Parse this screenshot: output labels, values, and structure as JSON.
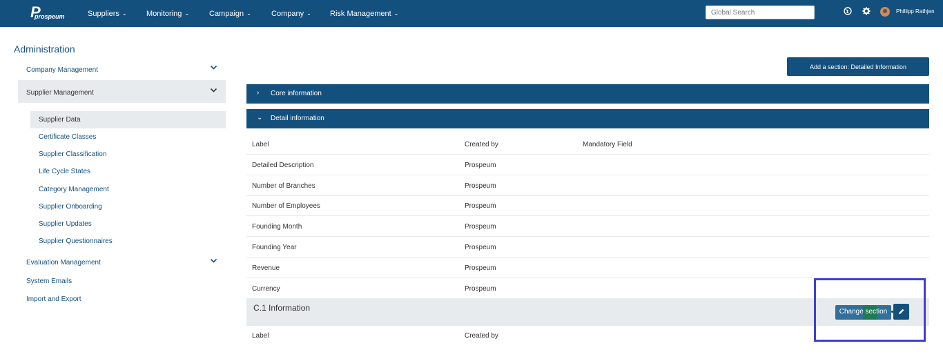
{
  "brand": {
    "logo_letter": "P",
    "logo_text": "prospeum"
  },
  "nav": {
    "items": [
      "Suppliers",
      "Monitoring",
      "Campaign",
      "Company",
      "Risk Management"
    ],
    "search_placeholder": "Global Search",
    "user_name": "Phillipp Rathjen",
    "icons": [
      "globe-icon",
      "gear-icon"
    ]
  },
  "sidebar": {
    "title": "Administration",
    "groups": [
      {
        "label": "Company Management"
      },
      {
        "label": "Supplier Management"
      },
      {
        "label": "Evaluation Management"
      },
      {
        "label": "System Emails"
      },
      {
        "label": "Import and Export"
      }
    ],
    "supplier_items": [
      "Supplier Data",
      "Certificate Classes",
      "Supplier Classification",
      "Life Cycle States",
      "Category Management",
      "Supplier Onboarding",
      "Supplier Updates",
      "Supplier Questionnaires"
    ]
  },
  "main": {
    "add_section_label": "Add a section: Detailed Information",
    "sections": [
      {
        "label": "Core information",
        "expanded": false
      },
      {
        "label": "Detail information",
        "expanded": true
      }
    ],
    "table": {
      "headers": [
        "Label",
        "Created by",
        "Mandatory Field"
      ],
      "rows": [
        {
          "label": "Detailed Description",
          "created_by": "Prospeum"
        },
        {
          "label": "Number of Branches",
          "created_by": "Prospeum"
        },
        {
          "label": "Number of Employees",
          "created_by": "Prospeum"
        },
        {
          "label": "Founding Month",
          "created_by": "Prospeum"
        },
        {
          "label": "Founding Year",
          "created_by": "Prospeum"
        },
        {
          "label": "Revenue",
          "created_by": "Prospeum"
        },
        {
          "label": "Currency",
          "created_by": "Prospeum"
        }
      ]
    },
    "subsection": {
      "title": "C.1 Information",
      "change_label": "Change section",
      "headers": [
        "Label",
        "Created by"
      ]
    }
  },
  "colors": {
    "primary": "#14507d",
    "band": "#e8ebee",
    "highlight": "#3f3fd1",
    "accent_green": "#1f7a55"
  }
}
